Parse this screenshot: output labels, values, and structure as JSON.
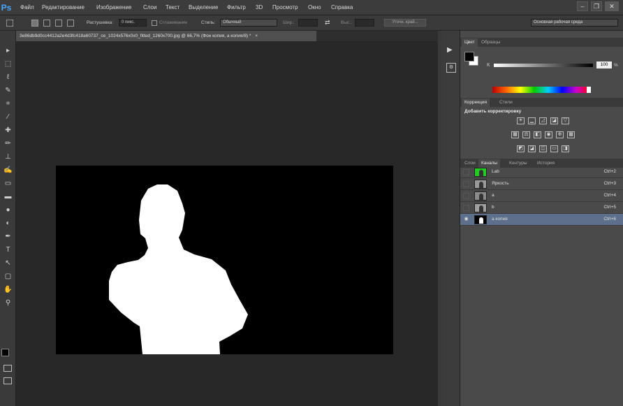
{
  "app": {
    "logo": "Ps"
  },
  "menu": [
    "Файл",
    "Редактирование",
    "Изображение",
    "Слои",
    "Текст",
    "Выделение",
    "Фильтр",
    "3D",
    "Просмотр",
    "Окно",
    "Справка"
  ],
  "window_controls": {
    "minimize": "–",
    "restore": "❐",
    "close": "✕"
  },
  "options_bar": {
    "feather_label": "Растушевка:",
    "feather_value": "0 пикс.",
    "antialias_label": "Сглаживание",
    "style_label": "Стиль:",
    "style_value": "Обычный",
    "width_label": "Шир.:",
    "height_label": "Выс.:",
    "refine_edge": "Уточн. край...",
    "workspace": "Основная рабочая среда"
  },
  "document": {
    "tab_title": "3e86db9d0cc4412a2e4d3fc418a60737_ce_1024x576x0x0_fitted_1260x700.jpg @ 66,7% (Фон копия, a копия/8) *",
    "close": "×"
  },
  "tools": [
    "move-icon",
    "marquee-icon",
    "lasso-icon",
    "quick-select-icon",
    "crop-icon",
    "eyedropper-icon",
    "healing-brush-icon",
    "brush-icon",
    "clone-stamp-icon",
    "history-brush-icon",
    "eraser-icon",
    "gradient-icon",
    "blur-icon",
    "dodge-icon",
    "pen-icon",
    "type-icon",
    "path-select-icon",
    "shape-icon",
    "hand-icon",
    "zoom-icon"
  ],
  "tool_glyphs": [
    "▸",
    "⬚",
    "ℓ",
    "✎",
    "⌗",
    "⁄",
    "✚",
    "✏",
    "⊥",
    "✍",
    "▭",
    "▬",
    "●",
    "◐",
    "✒",
    "T",
    "↖",
    "▢",
    "✋",
    "⚲"
  ],
  "color_panel": {
    "tabs": [
      "Цвет",
      "Образцы"
    ],
    "k_label": "K",
    "k_value": "100",
    "k_unit": "%"
  },
  "adjustments_panel": {
    "tabs": [
      "Коррекция",
      "Стили"
    ],
    "title": "Добавить корректировку"
  },
  "channels_panel": {
    "tabs": [
      "Слои",
      "Каналы",
      "Контуры",
      "История"
    ],
    "rows": [
      {
        "name": "Lab",
        "shortcut": "Ctrl+2",
        "thumb": "#22cc22",
        "visible": false,
        "selected": false
      },
      {
        "name": "Яркость",
        "shortcut": "Ctrl+3",
        "thumb": "#9a9a9a",
        "visible": false,
        "selected": false
      },
      {
        "name": "a",
        "shortcut": "Ctrl+4",
        "thumb": "#8a8a8a",
        "visible": false,
        "selected": false
      },
      {
        "name": "b",
        "shortcut": "Ctrl+5",
        "thumb": "#a0a0a0",
        "visible": false,
        "selected": false
      },
      {
        "name": "a копия",
        "shortcut": "Ctrl+6",
        "thumb": "#000000",
        "visible": true,
        "selected": true
      }
    ],
    "eye_glyph": "👁"
  },
  "colors": {
    "accent": "#49a8ff",
    "selected_row": "#5d6f8a",
    "canvas_bg": "#282828"
  }
}
